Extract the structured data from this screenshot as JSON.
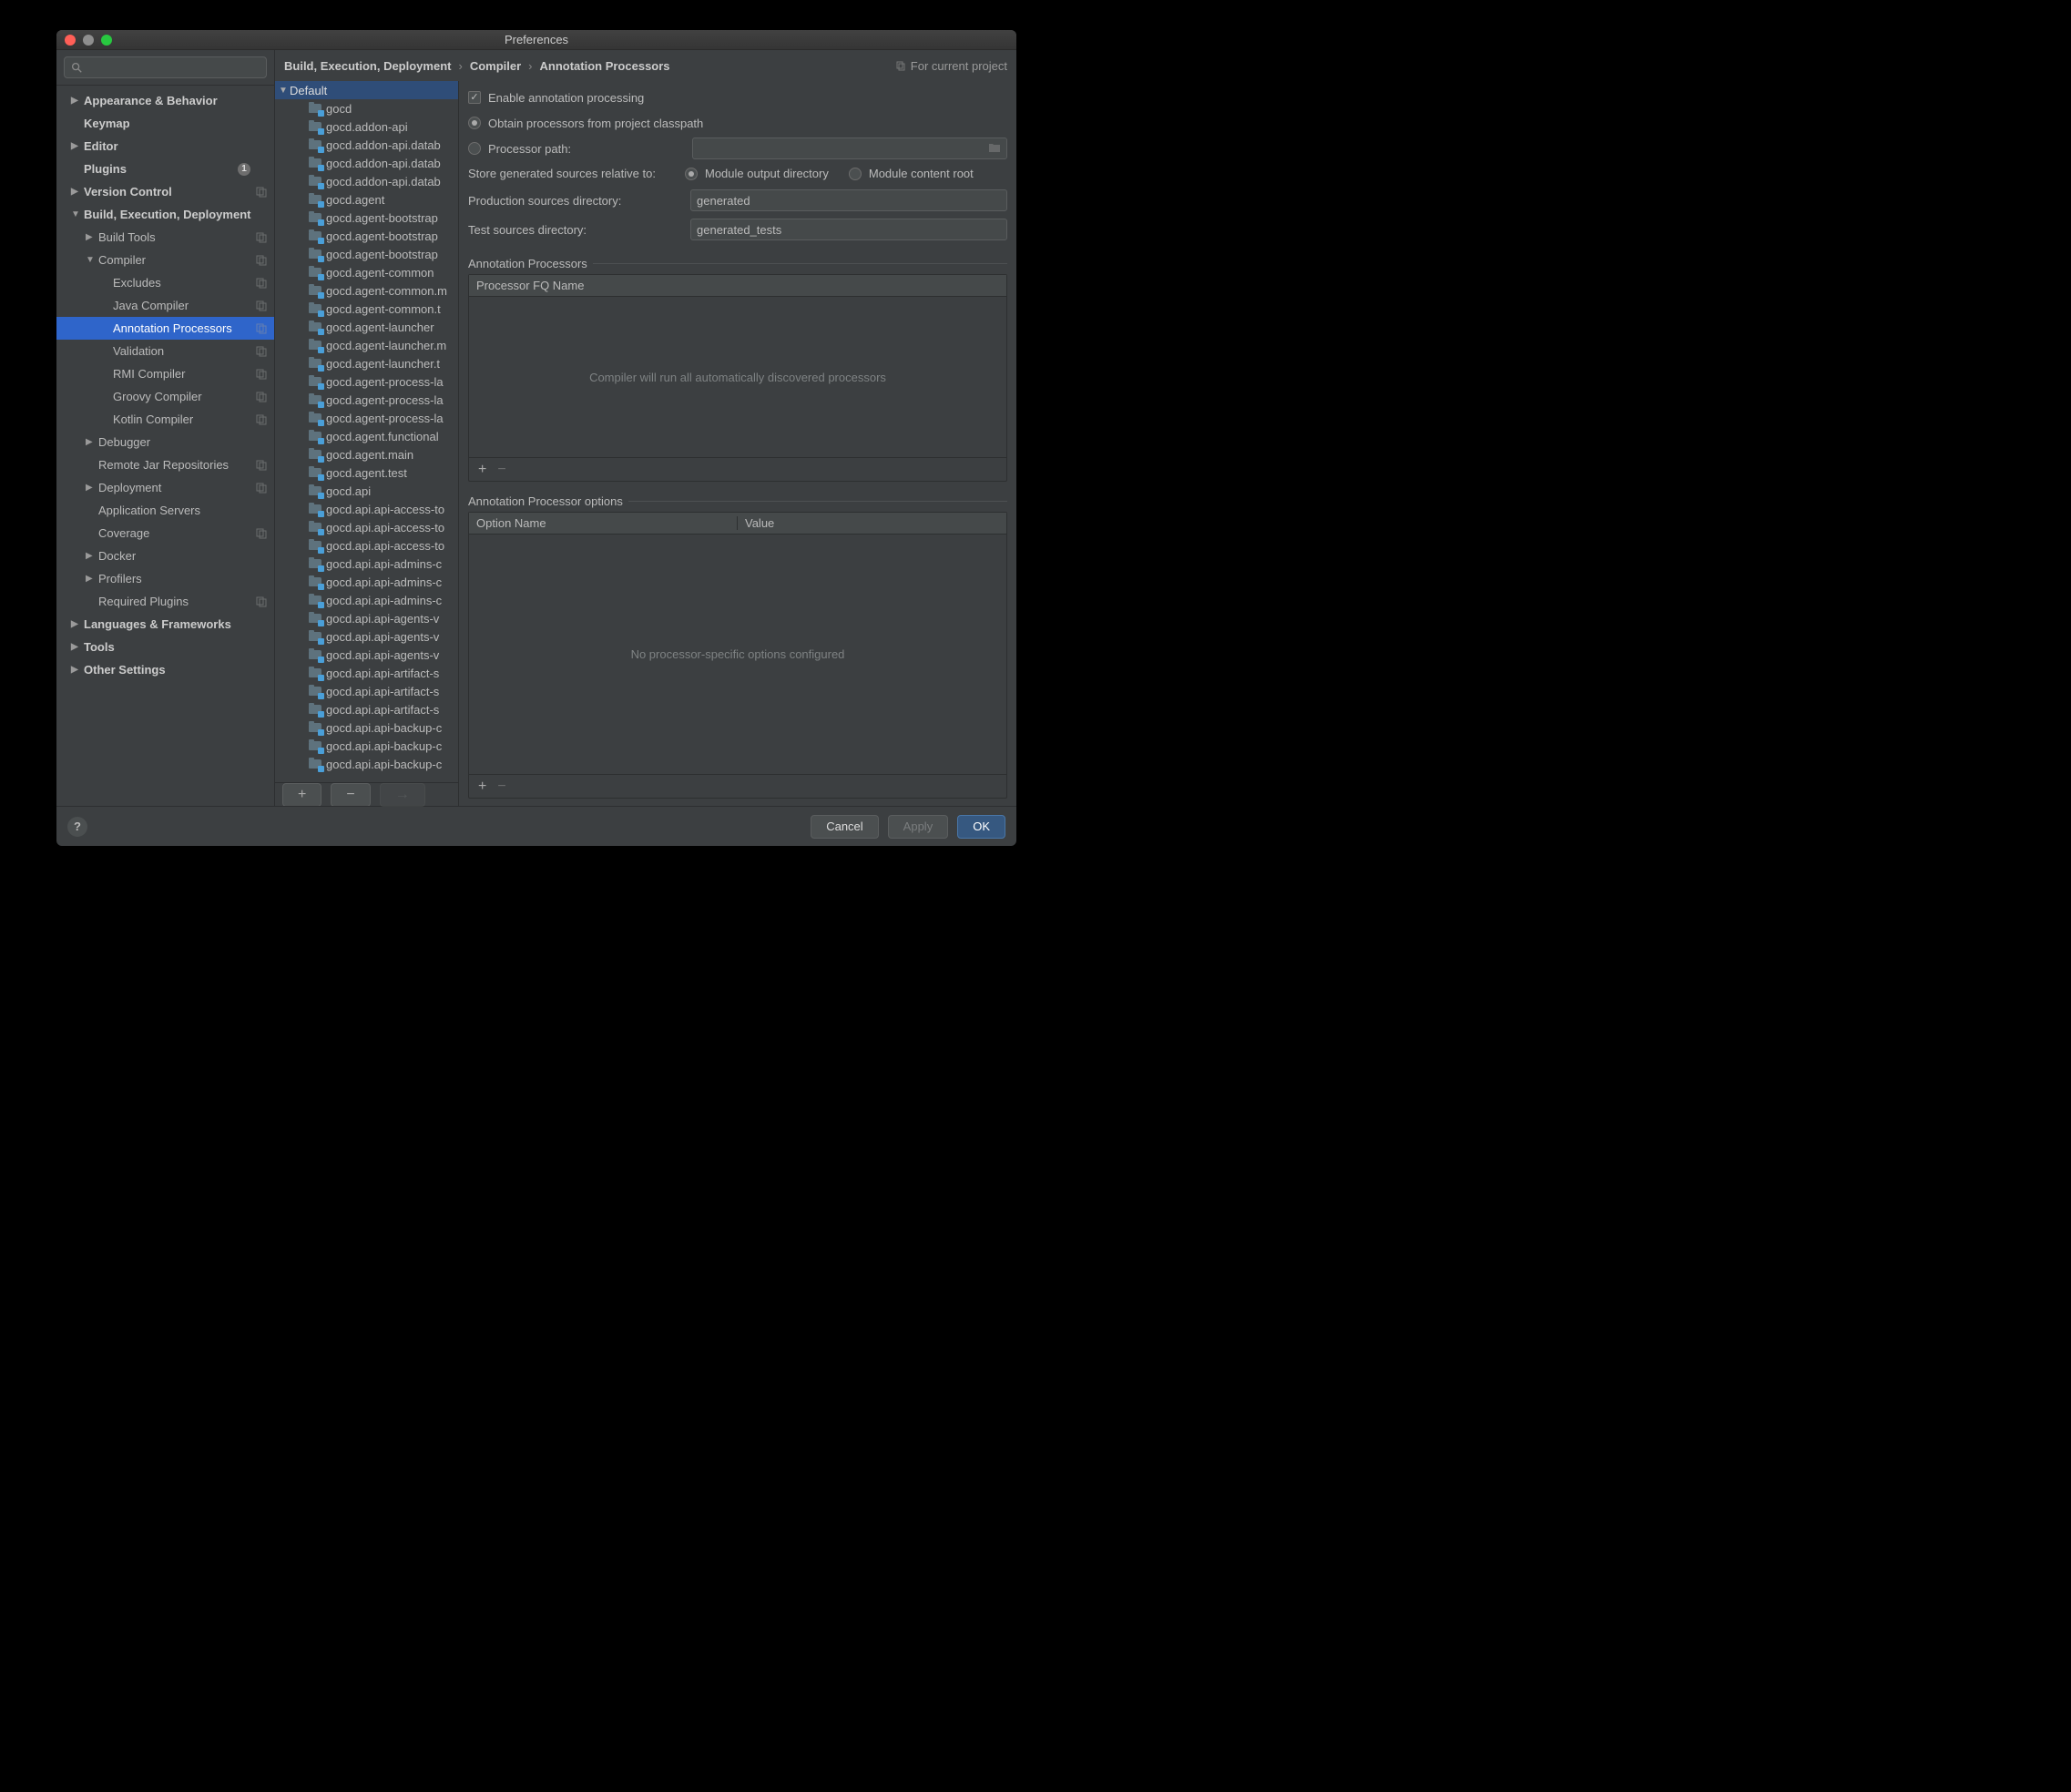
{
  "window": {
    "title": "Preferences"
  },
  "sidebar": {
    "search_placeholder": "",
    "items": [
      {
        "label": "Appearance & Behavior",
        "bold": true,
        "arrow": "▶",
        "indent": 1
      },
      {
        "label": "Keymap",
        "bold": true,
        "indent": 1
      },
      {
        "label": "Editor",
        "bold": true,
        "arrow": "▶",
        "indent": 1
      },
      {
        "label": "Plugins",
        "bold": true,
        "indent": 1,
        "badge": "1"
      },
      {
        "label": "Version Control",
        "bold": true,
        "arrow": "▶",
        "indent": 1,
        "copy": true
      },
      {
        "label": "Build, Execution, Deployment",
        "bold": true,
        "arrow": "▼",
        "indent": 1
      },
      {
        "label": "Build Tools",
        "arrow": "▶",
        "indent": 2,
        "copy": true
      },
      {
        "label": "Compiler",
        "arrow": "▼",
        "indent": 2,
        "copy": true
      },
      {
        "label": "Excludes",
        "indent": 3,
        "copy": true
      },
      {
        "label": "Java Compiler",
        "indent": 3,
        "copy": true
      },
      {
        "label": "Annotation Processors",
        "indent": 3,
        "copy": true,
        "selected": true
      },
      {
        "label": "Validation",
        "indent": 3,
        "copy": true
      },
      {
        "label": "RMI Compiler",
        "indent": 3,
        "copy": true
      },
      {
        "label": "Groovy Compiler",
        "indent": 3,
        "copy": true
      },
      {
        "label": "Kotlin Compiler",
        "indent": 3,
        "copy": true
      },
      {
        "label": "Debugger",
        "arrow": "▶",
        "indent": 2
      },
      {
        "label": "Remote Jar Repositories",
        "indent": 2,
        "copy": true
      },
      {
        "label": "Deployment",
        "arrow": "▶",
        "indent": 2,
        "copy": true
      },
      {
        "label": "Application Servers",
        "indent": 2
      },
      {
        "label": "Coverage",
        "indent": 2,
        "copy": true
      },
      {
        "label": "Docker",
        "arrow": "▶",
        "indent": 2
      },
      {
        "label": "Profilers",
        "arrow": "▶",
        "indent": 2
      },
      {
        "label": "Required Plugins",
        "indent": 2,
        "copy": true
      },
      {
        "label": "Languages & Frameworks",
        "bold": true,
        "arrow": "▶",
        "indent": 1
      },
      {
        "label": "Tools",
        "bold": true,
        "arrow": "▶",
        "indent": 1
      },
      {
        "label": "Other Settings",
        "bold": true,
        "arrow": "▶",
        "indent": 1
      }
    ]
  },
  "breadcrumb": {
    "a": "Build, Execution, Deployment",
    "b": "Compiler",
    "c": "Annotation Processors",
    "scope": "For current project"
  },
  "modules": {
    "group": "Default",
    "list": [
      "gocd",
      "gocd.addon-api",
      "gocd.addon-api.datab",
      "gocd.addon-api.datab",
      "gocd.addon-api.datab",
      "gocd.agent",
      "gocd.agent-bootstrap",
      "gocd.agent-bootstrap",
      "gocd.agent-bootstrap",
      "gocd.agent-common",
      "gocd.agent-common.m",
      "gocd.agent-common.t",
      "gocd.agent-launcher",
      "gocd.agent-launcher.m",
      "gocd.agent-launcher.t",
      "gocd.agent-process-la",
      "gocd.agent-process-la",
      "gocd.agent-process-la",
      "gocd.agent.functional",
      "gocd.agent.main",
      "gocd.agent.test",
      "gocd.api",
      "gocd.api.api-access-to",
      "gocd.api.api-access-to",
      "gocd.api.api-access-to",
      "gocd.api.api-admins-c",
      "gocd.api.api-admins-c",
      "gocd.api.api-admins-c",
      "gocd.api.api-agents-v",
      "gocd.api.api-agents-v",
      "gocd.api.api-agents-v",
      "gocd.api.api-artifact-s",
      "gocd.api.api-artifact-s",
      "gocd.api.api-artifact-s",
      "gocd.api.api-backup-c",
      "gocd.api.api-backup-c",
      "gocd.api.api-backup-c"
    ]
  },
  "form": {
    "enable": "Enable annotation processing",
    "obtain": "Obtain processors from project classpath",
    "procpath": "Processor path:",
    "store": "Store generated sources relative to:",
    "store_opt1": "Module output directory",
    "store_opt2": "Module content root",
    "prod_label": "Production sources directory:",
    "prod_value": "generated",
    "test_label": "Test sources directory:",
    "test_value": "generated_tests",
    "procs_title": "Annotation Processors",
    "fqname": "Processor FQ Name",
    "procs_empty": "Compiler will run all automatically discovered processors",
    "opts_title": "Annotation Processor options",
    "opt_name": "Option Name",
    "opt_value": "Value",
    "opts_empty": "No processor-specific options configured"
  },
  "footer": {
    "cancel": "Cancel",
    "apply": "Apply",
    "ok": "OK"
  }
}
